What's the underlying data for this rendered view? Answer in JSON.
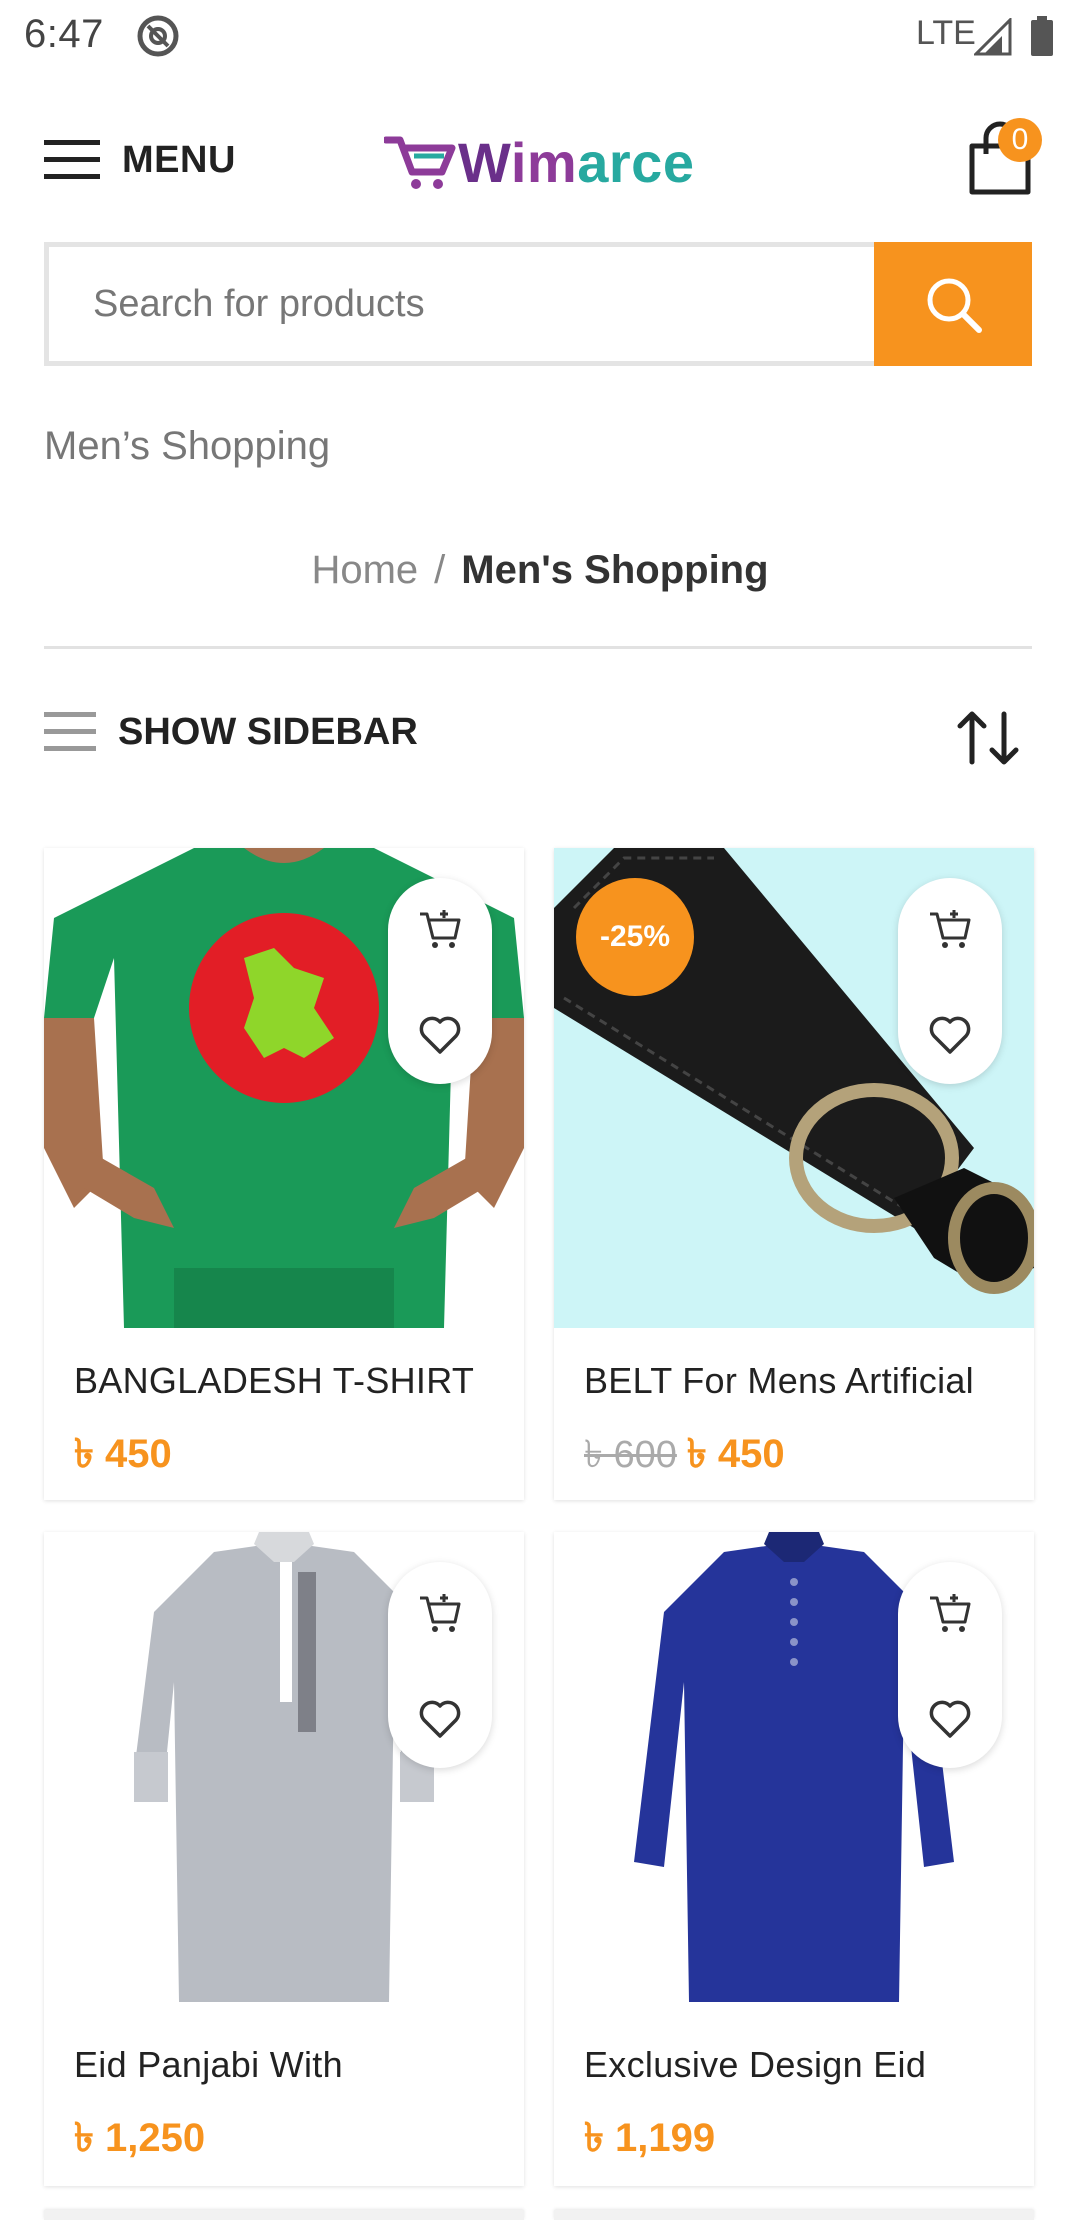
{
  "status_bar": {
    "time": "6:47",
    "network": "LTE"
  },
  "header": {
    "menu_label": "MENU",
    "logo": {
      "part1": "W",
      "part2": "im",
      "part3": "arce"
    },
    "cart_count": "0"
  },
  "search": {
    "placeholder": "Search for products"
  },
  "page": {
    "category_title": "Men’s Shopping",
    "breadcrumb": {
      "home": "Home",
      "separator": "/",
      "current": "Men's Shopping"
    },
    "sidebar_label": "SHOW SIDEBAR"
  },
  "products": [
    {
      "title": "BANGLADESH T-SHIRT",
      "price": "৳ 450"
    },
    {
      "title": "BELT For Mens Artificial",
      "old_price": "৳ 600",
      "price": "৳ 450",
      "badge": "-25%"
    },
    {
      "title": "Eid Panjabi With",
      "price": "৳ 1,250"
    },
    {
      "title": "Exclusive Design Eid",
      "price": "৳ 1,199"
    }
  ],
  "colors": {
    "accent": "#f7931e",
    "brand_purple": "#6a2f8a",
    "brand_teal": "#27a9a0"
  },
  "icons": [
    "ring-icon",
    "signal-icon",
    "battery-icon",
    "hamburger-icon",
    "cart-icon",
    "search-icon",
    "sidebar-icon",
    "sort-icon",
    "add-to-cart-icon",
    "heart-icon"
  ]
}
